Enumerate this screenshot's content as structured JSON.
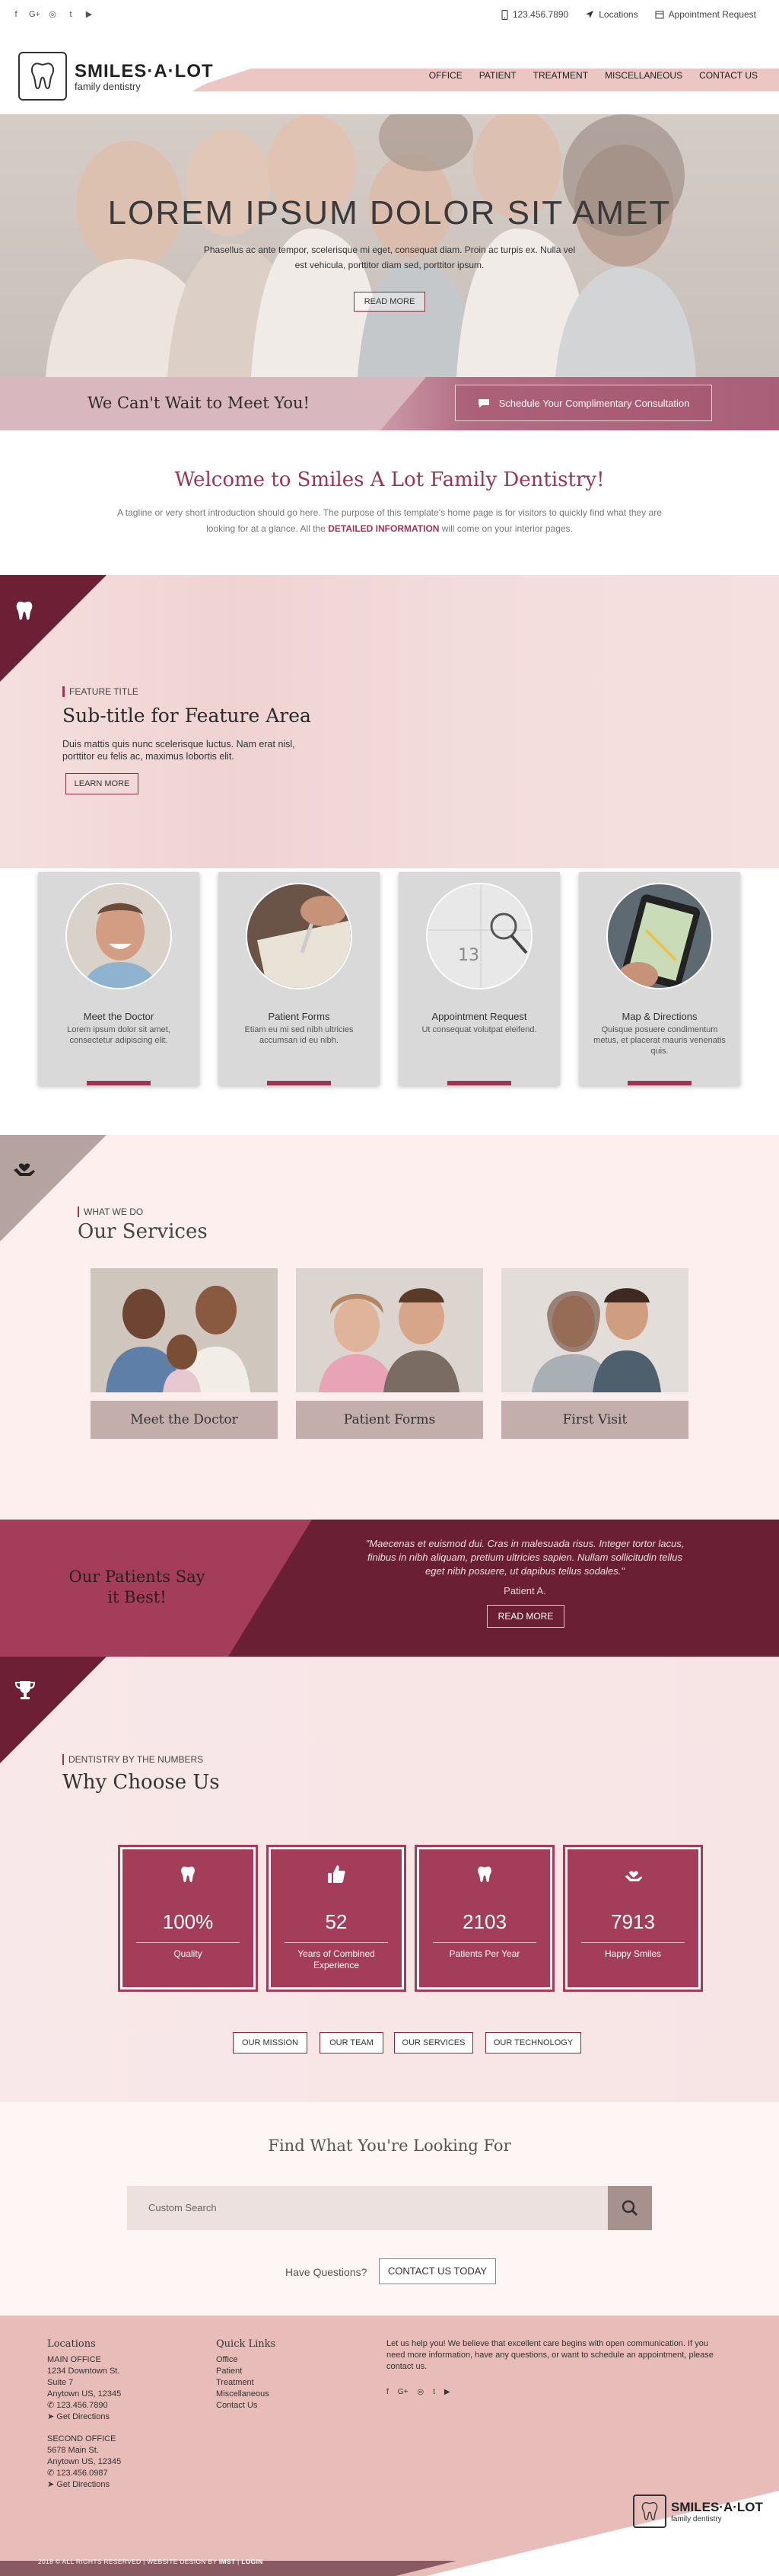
{
  "topbar": {
    "social": [
      "f",
      "G+",
      "◎",
      "t",
      "▶"
    ],
    "phone": "123.456.7890",
    "locations": "Locations",
    "appointment": "Appointment Request"
  },
  "logo": {
    "name": "SMILES·A·LOT",
    "tagline": "family dentistry"
  },
  "nav": [
    "OFFICE",
    "PATIENT",
    "TREATMENT",
    "MISCELLANEOUS",
    "CONTACT US"
  ],
  "hero": {
    "title": "LOREM IPSUM DOLOR SIT AMET",
    "text": "Phasellus ac ante tempor, scelerisque mi eget, consequat diam. Proin ac turpis ex. Nulla vel est vehicula, porttitor diam sed, porttitor ipsum.",
    "button": "READ MORE"
  },
  "meet": {
    "title": "We Can't Wait to Meet You!",
    "button": "Schedule Your Complimentary Consultation"
  },
  "welcome": {
    "title": "Welcome to Smiles A Lot Family Dentistry!",
    "text_before": "A tagline or very short introduction should go here. The purpose of this template's home page is for visitors to quickly find what they are looking for at a glance. All the",
    "link": "DETAILED INFORMATION",
    "text_after": "will come on your interior pages."
  },
  "feature": {
    "label": "FEATURE TITLE",
    "title": "Sub-title for Feature Area",
    "text": "Duis mattis quis nunc scelerisque luctus. Nam erat nisl, porttitor eu felis ac, maximus lobortis elit.",
    "button": "LEARN MORE"
  },
  "cards": [
    {
      "title": "Meet the Doctor",
      "desc": "Lorem ipsum dolor sit amet, consectetur adipiscing elit."
    },
    {
      "title": "Patient Forms",
      "desc": "Etiam eu mi sed nibh ultricies accumsan id eu nibh."
    },
    {
      "title": "Appointment Request",
      "desc": "Ut consequat volutpat eleifend."
    },
    {
      "title": "Map & Directions",
      "desc": "Quisque posuere condimentum metus, et placerat mauris venenatis quis."
    }
  ],
  "services": {
    "label": "WHAT WE DO",
    "title": "Our Services",
    "items": [
      "Meet the Doctor",
      "Patient Forms",
      "First Visit"
    ]
  },
  "testimonial": {
    "heading": "Our Patients Say it Best!",
    "quote": "\"Maecenas et euismod dui. Cras in malesuada risus. Integer tortor lacus, finibus in nibh aliquam, pretium ultricies sapien. Nullam sollicitudin tellus eget nibh posuere, ut dapibus tellus sodales.\"",
    "author": "Patient A.",
    "button": "READ MORE"
  },
  "why": {
    "label": "DENTISTRY BY THE NUMBERS",
    "title": "Why Choose Us",
    "stats": [
      {
        "value": "100%",
        "label": "Quality",
        "icon": "tooth-icon"
      },
      {
        "value": "52",
        "label": "Years of Combined Experience",
        "icon": "thumbs-up-icon"
      },
      {
        "value": "2103",
        "label": "Patients Per Year",
        "icon": "tooth-icon"
      },
      {
        "value": "7913",
        "label": "Happy Smiles",
        "icon": "hand-heart-icon"
      }
    ],
    "buttons": [
      "OUR MISSION",
      "OUR TEAM",
      "OUR SERVICES",
      "OUR TECHNOLOGY"
    ]
  },
  "search": {
    "title": "Find What You're Looking For",
    "placeholder": "Custom Search",
    "question": "Have Questions?",
    "button": "CONTACT US TODAY"
  },
  "footer": {
    "locations_title": "Locations",
    "main_office": {
      "label": "MAIN OFFICE",
      "line1": "1234 Downtown St.",
      "line2": "Suite 7",
      "line3": "Anytown US, 12345",
      "phone": "123.456.7890",
      "directions": "Get Directions"
    },
    "second_office": {
      "label": "SECOND OFFICE",
      "line1": "5678 Main St.",
      "line2": "Anytown US, 12345",
      "phone": "123.456.0987",
      "directions": "Get Directions"
    },
    "quick_title": "Quick Links",
    "quick_links": [
      "Office",
      "Patient",
      "Treatment",
      "Miscellaneous",
      "Contact Us"
    ],
    "about": "Let us help you! We believe that excellent care begins with open communication. If you need more information, have any questions, or want to schedule an appointment, please contact us.",
    "copyright": "2018 © ALL RIGHTS RESERVED | WEBSITE DESIGN BY",
    "designer": "IMST",
    "login": "LOGIN"
  },
  "colors": {
    "brand": "#9c3552",
    "brand_dark": "#6d1f35",
    "pink_light": "#f5e0df",
    "footer": "#e8bcb8"
  }
}
